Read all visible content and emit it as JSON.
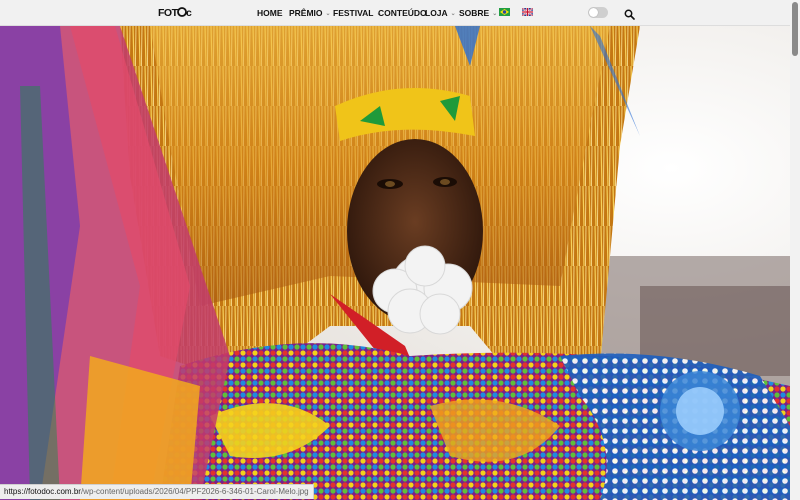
{
  "site": {
    "logo_text": "FOTODOC"
  },
  "nav": {
    "items": [
      {
        "label": "HOME",
        "has_dropdown": false
      },
      {
        "label": "PRÊMIO",
        "has_dropdown": true
      },
      {
        "label": "FESTIVAL",
        "has_dropdown": true
      },
      {
        "label": "CONTEÚDO",
        "has_dropdown": false
      },
      {
        "label": "LOJA",
        "has_dropdown": true
      },
      {
        "label": "SOBRE",
        "has_dropdown": true
      }
    ],
    "languages": [
      {
        "icon": "brazil-flag-icon"
      },
      {
        "icon": "uk-flag-icon"
      }
    ],
    "theme_toggle_icon": "dark-mode-toggle",
    "search_icon": "search-icon"
  },
  "hero": {
    "image_icon": "festival-portrait-photo"
  },
  "status_bar": {
    "host": "https://fotodoc.com.br",
    "path": "/wp-content/uploads/2026/04/PPF2026-6-346-01-Carol-Melo.jpg"
  },
  "colors": {
    "nav_bg": "#f1f1f1",
    "text": "#111111"
  }
}
